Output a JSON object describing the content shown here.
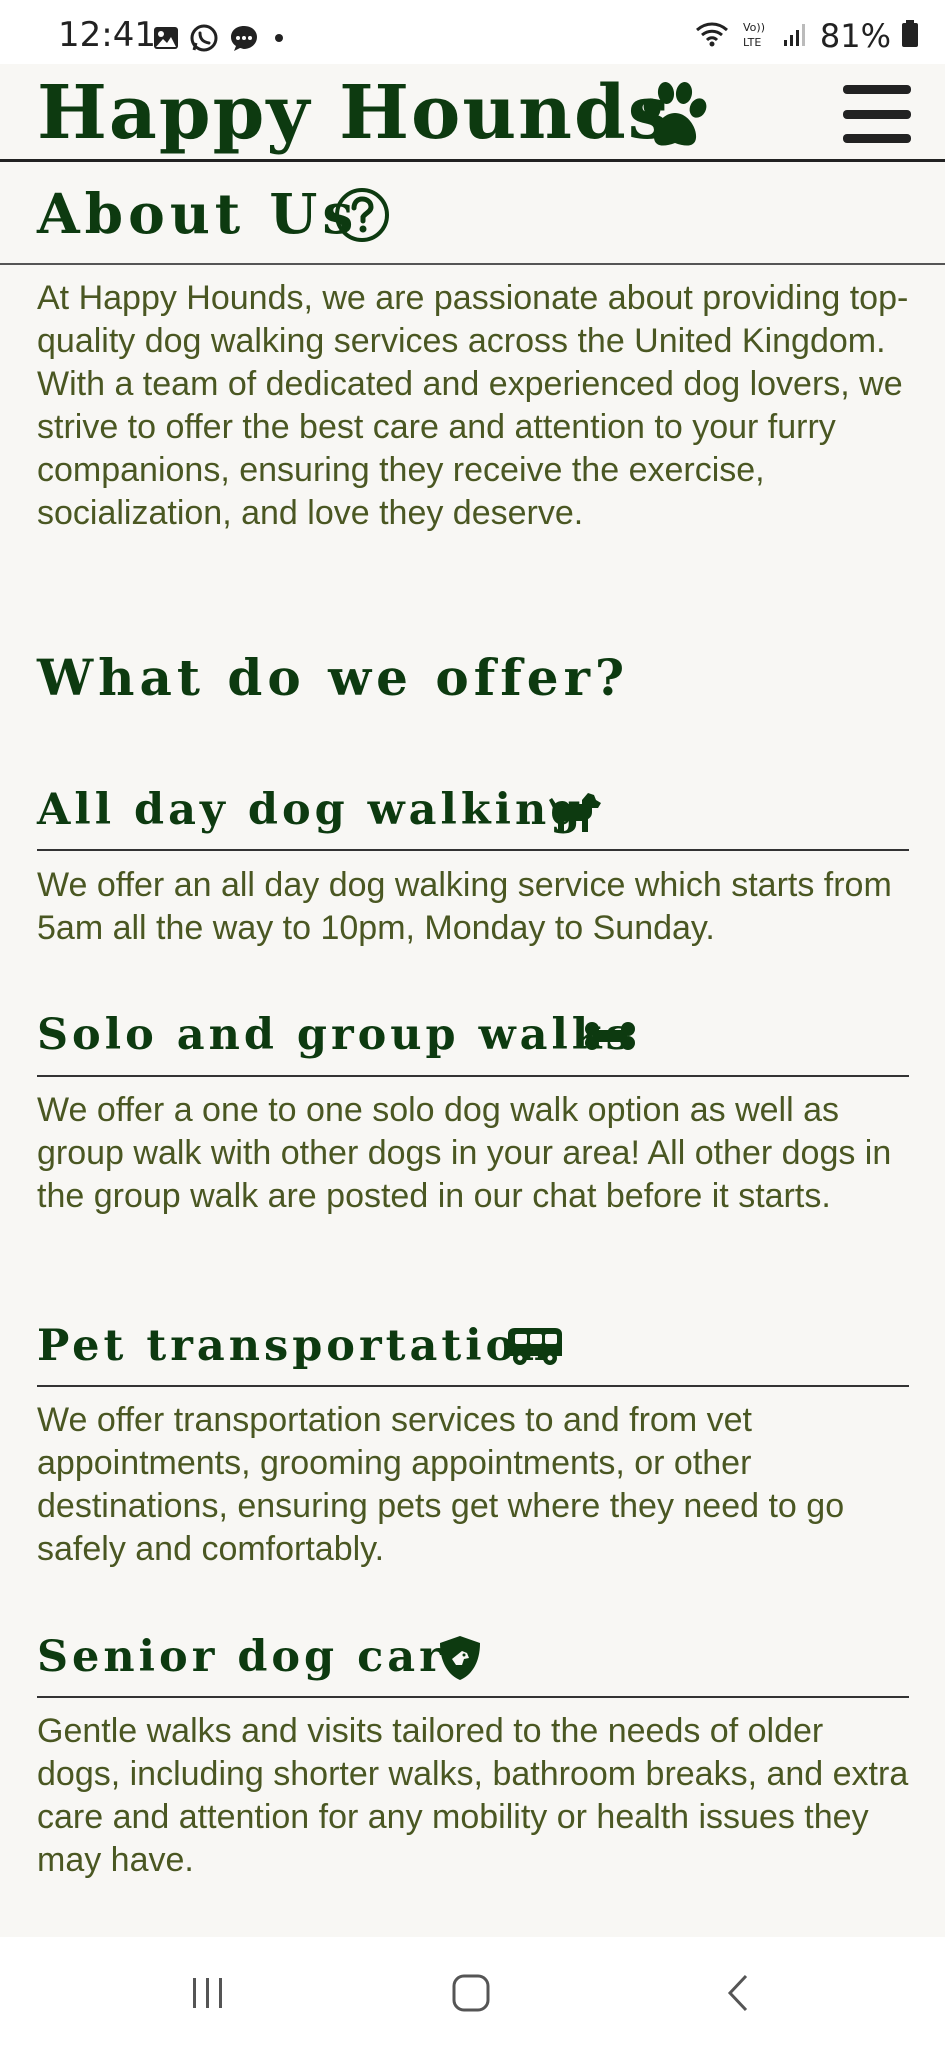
{
  "status_bar": {
    "time": "12:41",
    "battery": "81%",
    "left_icons": [
      "gallery-icon",
      "whatsapp-icon",
      "messages-icon",
      "dot-icon"
    ],
    "right_icons": [
      "wifi-icon",
      "volte-icon",
      "signal-icon",
      "battery-icon"
    ]
  },
  "header": {
    "brand": "Happy Hounds",
    "brand_icon": "paw-icon",
    "menu_icon": "hamburger-menu-icon"
  },
  "about": {
    "title": "About Us",
    "icon": "question-circle-icon",
    "text": "At Happy Hounds, we are passionate about providing top-quality dog walking services across the United Kingdom. With a team of dedicated and experienced dog lovers, we strive to offer the best care and attention to your furry companions, ensuring they receive the exercise, socialization, and love they deserve."
  },
  "offer": {
    "title": "What do we offer?",
    "services": [
      {
        "title": "All day dog walking",
        "icon": "dog-icon",
        "text": "We offer an all day dog walking service which starts from 5am all the way to 10pm, Monday to Sunday."
      },
      {
        "title": "Solo and group walks",
        "icon": "bone-icon",
        "text": "We offer a one to one solo dog walk option as well as group walk with other dogs in your area! All other dogs in the group walk are posted in our chat before it starts."
      },
      {
        "title": "Pet transportation",
        "icon": "van-icon",
        "text": "We offer transportation services to and from vet appointments, grooming appointments, or other destinations, ensuring pets get where they need to go safely and comfortably."
      },
      {
        "title": "Senior dog care",
        "icon": "shield-dog-icon",
        "text": "Gentle walks and visits tailored to the needs of older dogs, including shorter walks, bathroom breaks, and extra care and attention for any mobility or health issues they may have."
      }
    ]
  },
  "bottom_nav": {
    "icons": [
      "recent-apps-icon",
      "home-icon",
      "back-icon"
    ]
  },
  "colors": {
    "background": "#f8f7f4",
    "heading": "#0d3a10",
    "body_text": "#4a5722",
    "rule": "#333333"
  }
}
